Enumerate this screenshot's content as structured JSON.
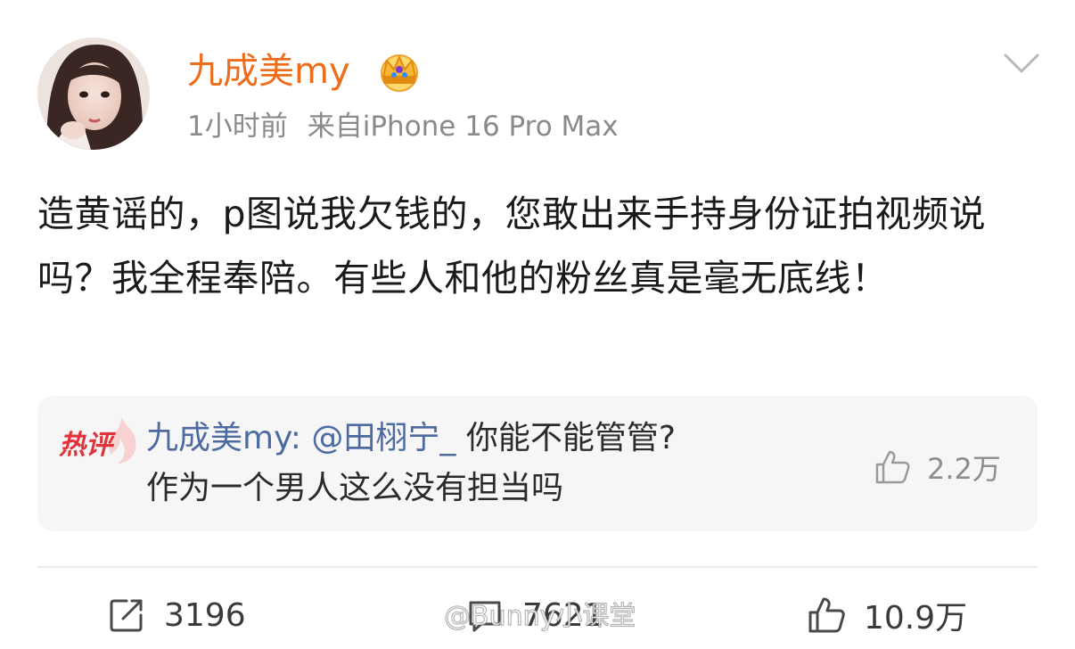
{
  "post": {
    "author": {
      "name": "九成美my",
      "avatar_icon": "avatar-portrait",
      "badge_icon": "crown-icon"
    },
    "time": "1小时前",
    "source": "来自iPhone 16 Pro Max",
    "text": "造黄谣的，p图说我欠钱的，您敢出来手持身份证拍视频说吗？我全程奉陪。有些人和他的粉丝真是毫无底线！"
  },
  "hot_comment": {
    "badge": "热评",
    "author": "九成美my:",
    "mention": "@田栩宁_",
    "text_line1": "你能不能管管?",
    "text_line2": "作为一个男人这么没有担当吗",
    "likes": "2.2万"
  },
  "actions": {
    "repost": "3196",
    "comments": "7621",
    "likes": "10.9万"
  },
  "watermark": "@Bunny小课堂",
  "colors": {
    "username": "#ee6d1b",
    "meta": "#8a8a8a",
    "link": "#4d6aa1",
    "hot_badge": "#e2333a",
    "card_bg": "#f6f6f7"
  }
}
